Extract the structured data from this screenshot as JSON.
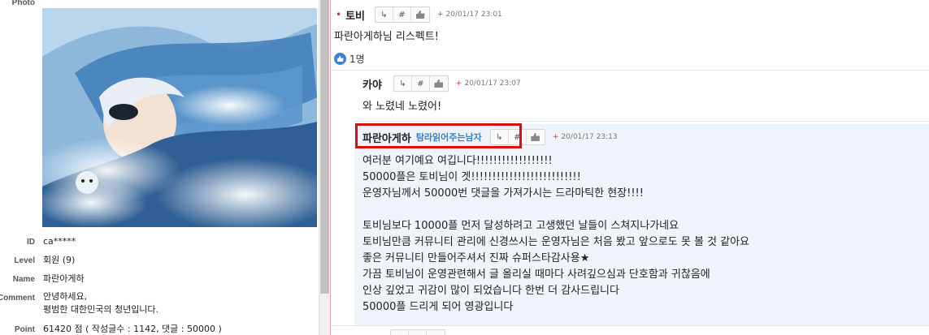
{
  "profile": {
    "labels": {
      "photo": "Photo",
      "id": "ID",
      "level": "Level",
      "name": "Name",
      "comment": "Comment",
      "point": "Point"
    },
    "id": "ca*****",
    "level": "회원 (9)",
    "name": "파란아게하",
    "comment_line1": "안녕하세요,",
    "comment_line2": "평범한 대한민국의 청년입니다.",
    "point": "61420 점 ( 작성글수 : 1142, 댓글 : 50000 )"
  },
  "comments": [
    {
      "author": "토비",
      "time": "20/01/17 23:01",
      "text": "파란아게하님 리스펙트!",
      "likes": "1명"
    },
    {
      "author": "카야",
      "time": "20/01/17 23:07",
      "text": "와 노렸네 노렸어!"
    },
    {
      "author": "파란아게하",
      "nick": "탐라읽어주는남자",
      "time": "20/01/17 23:13",
      "lines": [
        "여러분 여기예요 여깁니다!!!!!!!!!!!!!!!!!!",
        "50000플은 토비님이 겟!!!!!!!!!!!!!!!!!!!!!!!!!!",
        "운영자님께서 50000번 댓글을 가져가시는 드라마틱한 현장!!!!",
        "",
        "토비님보다 10000플 먼저 달성하려고 고생했던 날들이 스쳐지나가네요",
        "토비님만큼 커뮤니티 관리에 신경쓰시는 운영자님은 처음 봤고 앞으로도 못 볼 것 같아요",
        "좋은 커뮤니티 만들어주셔서 진짜 슈퍼스타감사용★",
        "가끔 토비님이 운영관련해서 글 올리실 때마다 사려깊으심과 단호함과 귀찮음에",
        "인상 깊었고 귀감이 많이 되었습니다 한번 더 감사드립니다",
        "50000플 드리게 되어 영광입니다"
      ]
    }
  ],
  "buttons": {
    "reply": "↳",
    "hash": "#"
  },
  "colors": {
    "highlight_border": "#d90f0f",
    "reply_bg": "#eef4f9",
    "nick_blue": "#3b82c4"
  }
}
